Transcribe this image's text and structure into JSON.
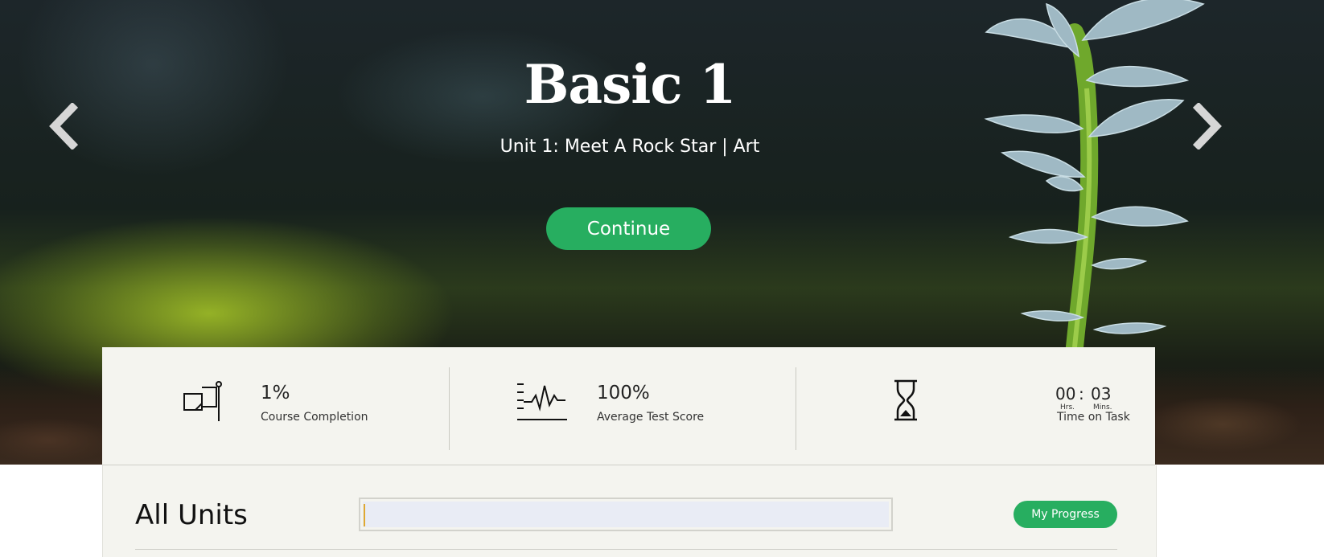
{
  "hero": {
    "title": "Basic 1",
    "subtitle": "Unit 1: Meet A Rock Star |  Art",
    "continue_label": "Continue",
    "prev_icon": "chevron-left-icon",
    "next_icon": "chevron-right-icon"
  },
  "stats": {
    "completion": {
      "value": "1%",
      "label": "Course Completion",
      "icon": "flag-icon"
    },
    "test_score": {
      "value": "100%",
      "label": "Average Test Score",
      "icon": "pulse-chart-icon"
    },
    "time": {
      "hours": "00",
      "separator": ":",
      "minutes": "03",
      "hours_label": "Hrs.",
      "minutes_label": "Mins.",
      "label": "Time on Task",
      "icon": "hourglass-icon"
    }
  },
  "units": {
    "title": "All Units",
    "search_value": "",
    "progress_label": "My Progress"
  },
  "colors": {
    "accent": "#27ae60",
    "panel": "#f4f4ef"
  }
}
